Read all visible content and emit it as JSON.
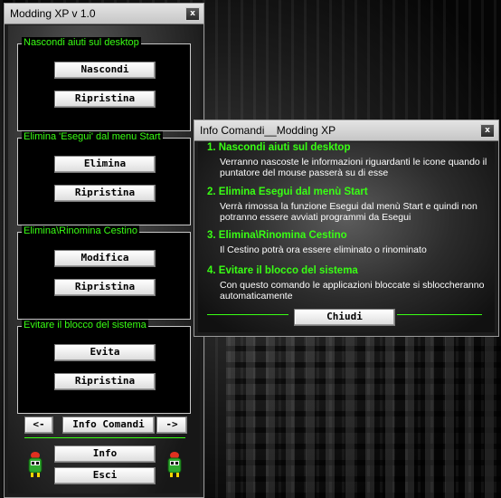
{
  "main_window": {
    "title": "Modding XP v 1.0",
    "close_label": "x",
    "groups": [
      {
        "title": "Nascondi aiuti sul desktop",
        "buttons": [
          "Nascondi",
          "Ripristina"
        ]
      },
      {
        "title": "Elimina 'Esegui' dal menu Start",
        "buttons": [
          "Elimina",
          "Ripristina"
        ]
      },
      {
        "title": "Elimina\\Rinomina Cestino",
        "buttons": [
          "Modifica",
          "Ripristina"
        ]
      },
      {
        "title": "Evitare il blocco del sistema",
        "buttons": [
          "Evita",
          "Ripristina"
        ]
      }
    ],
    "nav": {
      "prev": "<-",
      "info_commands": "Info Comandi",
      "next": "->"
    },
    "bottom": {
      "info": "Info",
      "exit": "Esci"
    }
  },
  "info_window": {
    "title": "Info Comandi__Modding XP",
    "close_label": "x",
    "items": [
      {
        "heading": "1. Nascondi aiuti sul desktop",
        "text": "Verranno nascoste le informazioni riguardanti le icone quando il puntatore del mouse passerà su di esse"
      },
      {
        "heading": "2. Elimina Esegui dal menù Start",
        "text": "Verrà rimossa la funzione Esegui dal menù Start e quindi non potranno essere avviati programmi da Esegui"
      },
      {
        "heading": "3. Elimina\\Rinomina Cestino",
        "text": "Il Cestino potrà ora essere eliminato o rinominato"
      },
      {
        "heading": "4. Evitare il blocco del sistema",
        "text": "Con questo comando le applicazioni bloccate si sbloccheranno automaticamente"
      }
    ],
    "close_button": "Chiudi"
  },
  "colors": {
    "accent_green": "#39ff14",
    "button_face": "#e8e8e8"
  },
  "icons": [
    "close-icon",
    "robot-mascot-icon"
  ]
}
